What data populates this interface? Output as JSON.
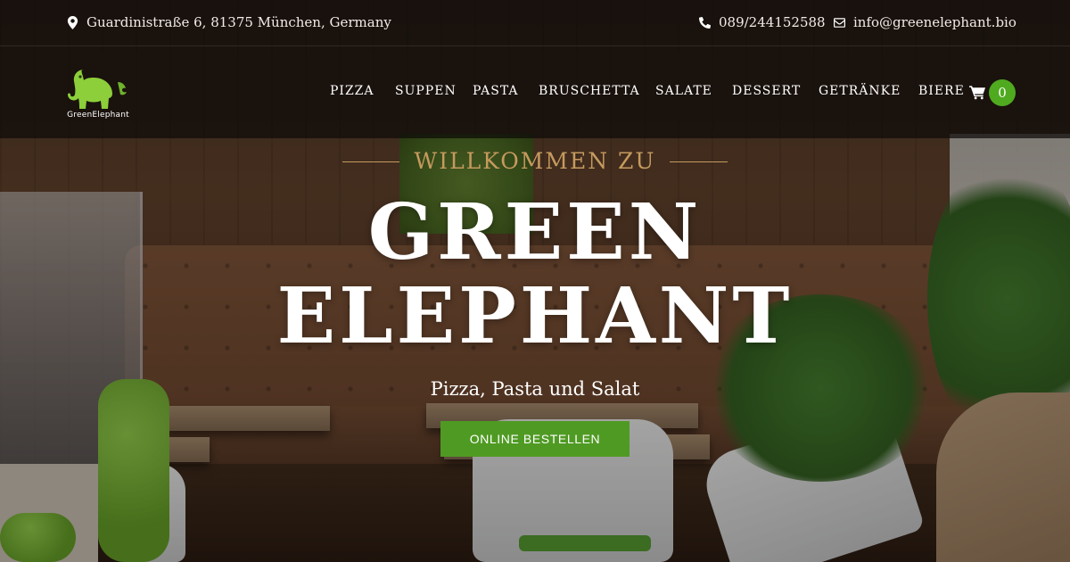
{
  "topbar": {
    "address": "Guardinistraße 6, 81375 München, Germany",
    "phone": "089/244152588",
    "email": "info@greenelephant.bio"
  },
  "brand": {
    "logo_text": "GreenElephant",
    "accent_color": "#4f9a23",
    "gold_color": "#c59a5e"
  },
  "nav": {
    "items": [
      "PIZZA",
      "SUPPEN",
      "PASTA",
      "BRUSCHETTA",
      "SALATE",
      "DESSERT",
      "GETRÄNKE",
      "BIERE"
    ],
    "cart_count": "0"
  },
  "hero": {
    "welcome": "WILLKOMMEN ZU",
    "title_line1": "GREEN",
    "title_line2": "ELEPHANT",
    "subtitle": "Pizza, Pasta und Salat",
    "cta_label": "ONLINE BESTELLEN"
  },
  "icons": {
    "address": "map-marker-icon",
    "phone": "phone-icon",
    "email": "envelope-icon",
    "cart": "shopping-cart-icon"
  }
}
